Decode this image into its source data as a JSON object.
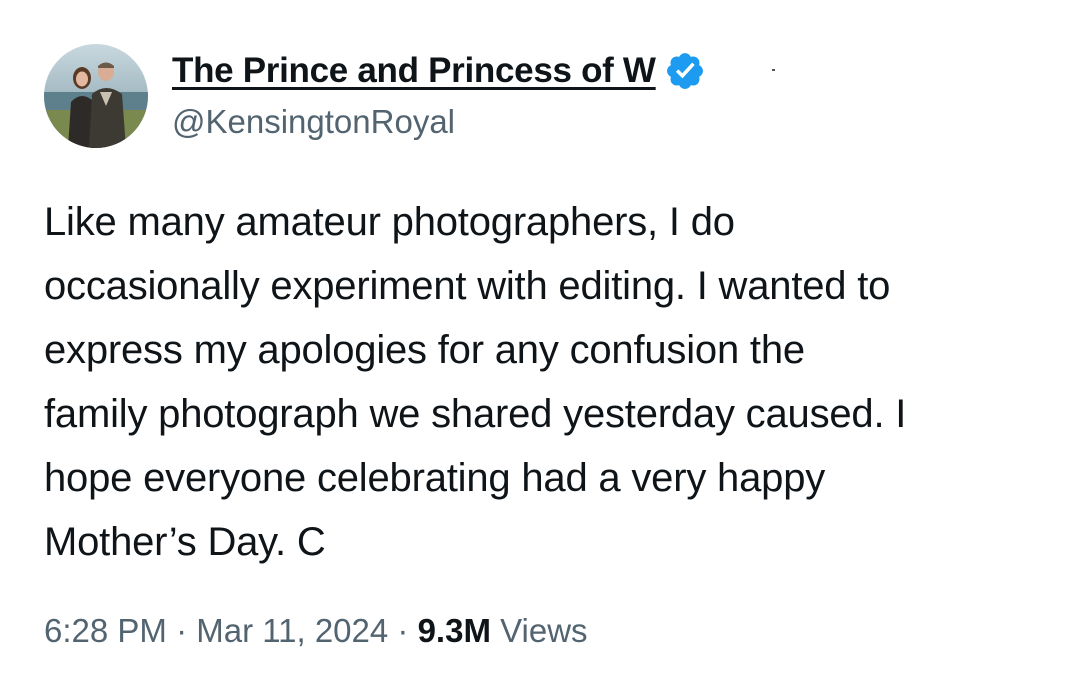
{
  "author": {
    "display_name": "The Prince and Princess of W",
    "handle": "@KensingtonRoyal",
    "verified_badge_icon": "verified-badge-icon",
    "verified_badge_color": "#1d9bf0"
  },
  "tweet": {
    "lines": [
      "Like many amateur photographers, I do",
      "occasionally experiment with editing. I wanted to",
      "express my apologies for any confusion the",
      "family photograph we shared yesterday caused. I",
      "hope everyone celebrating had a very happy",
      "Mother’s Day. C"
    ]
  },
  "meta": {
    "time": "6:28 PM",
    "separator": " · ",
    "date": "Mar 11, 2024",
    "views_count": "9.3M",
    "views_label": "Views"
  },
  "colors": {
    "text_primary": "#0f1419",
    "text_secondary": "#536471",
    "accent": "#1d9bf0"
  }
}
